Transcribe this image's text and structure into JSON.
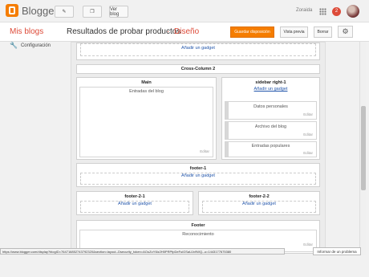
{
  "topbar": {
    "brand": "Blogger",
    "view_blog_label": "Ver blog",
    "user_name": "Zoraida",
    "notification_count": "2"
  },
  "subbar": {
    "my_blogs": "Mis blogs",
    "blog_title": "Resultados de probar productos",
    "separator": "·",
    "section": "Diseño",
    "save_label": "Guardar disposición",
    "preview_label": "Vista previa",
    "delete_label": "Borrar"
  },
  "sidebar": {
    "items": [
      {
        "label": "Configuración",
        "icon": "wrench-icon"
      }
    ]
  },
  "layout": {
    "top_panel": {
      "add_label": "Añadir un gadget"
    },
    "cross_column": {
      "title": "Cross-Column 2"
    },
    "main": {
      "title": "Main",
      "gadget": "Entradas del blog",
      "edit": "Editar"
    },
    "sidebar_right": {
      "title": "sidebar right-1",
      "add_label": "Añadir un gadget",
      "gadgets": [
        {
          "label": "Datos personales",
          "edit": "Editar"
        },
        {
          "label": "Archivo del blog",
          "edit": "Editar"
        },
        {
          "label": "Entradas populares",
          "edit": "Editar"
        }
      ]
    },
    "footer1": {
      "title": "footer-1",
      "add_label": "Añadir un gadget"
    },
    "footer21": {
      "title": "footer-2-1",
      "add_label": "Añadir un gadget"
    },
    "footer22": {
      "title": "footer-2-2",
      "add_label": "Añadir un gadget"
    },
    "footer": {
      "title": "Footer",
      "gadget": "Reconocimiento",
      "edit": "Editar"
    }
  },
  "status_url": "https://www.blogger.com/display?blogID=764716852743792320&section=layout--Dsecurity_token=AOuZoY6lz2H5PRPfpDeFuiGSaUJx9WQ--u=1443177675380",
  "report_label": "Informar de un problema"
}
